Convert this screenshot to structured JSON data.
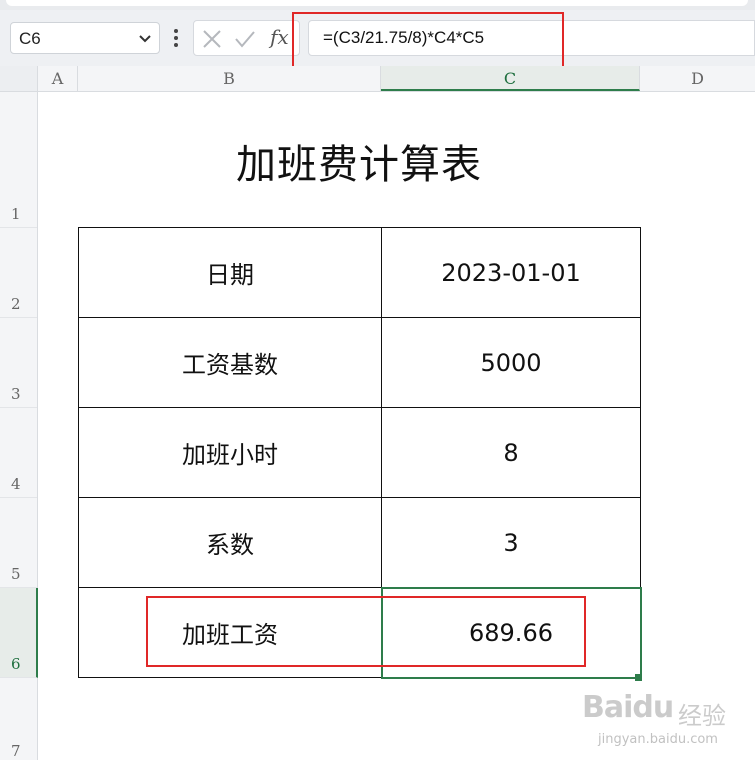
{
  "formula_bar": {
    "name_box": "C6",
    "fx_label": "fx",
    "formula": "=(C3/21.75/8)*C4*C5"
  },
  "columns": [
    "A",
    "B",
    "C",
    "D"
  ],
  "rows": [
    "1",
    "2",
    "3",
    "4",
    "5",
    "6",
    "7"
  ],
  "selected_cell": "C6",
  "sheet": {
    "title": "加班费计算表",
    "table": [
      {
        "label": "日期",
        "value": "2023-01-01"
      },
      {
        "label": "工资基数",
        "value": "5000"
      },
      {
        "label": "加班小时",
        "value": "8"
      },
      {
        "label": "系数",
        "value": "3"
      },
      {
        "label": "加班工资",
        "value": "689.66"
      }
    ]
  },
  "watermark": {
    "brand": "Baidu",
    "cn": "经验",
    "url": "jingyan.baidu.com"
  },
  "colors": {
    "highlight": "#e02828",
    "selection": "#2e7d4b"
  }
}
